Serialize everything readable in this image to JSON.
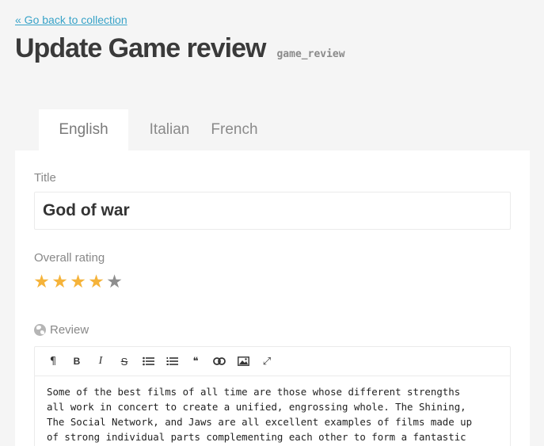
{
  "back_link": "« Go back to collection",
  "header": {
    "title": "Update Game review",
    "api_id": "game_review"
  },
  "tabs": [
    {
      "label": "English",
      "active": true
    },
    {
      "label": "Italian",
      "active": false
    },
    {
      "label": "French",
      "active": false
    }
  ],
  "form": {
    "title_label": "Title",
    "title_value": "God of war",
    "rating_label": "Overall rating",
    "rating_value": 4,
    "rating_max": 5,
    "review_label": "Review",
    "review_text": "Some of the best films of all time are those whose different strengths\nall work in concert to create a unified, engrossing whole. The Shining,\nThe Social Network, and Jaws are all excellent examples of films made up\nof strong individual parts complementing each other to form a fantastic"
  },
  "toolbar": {
    "paragraph": "¶",
    "bold": "B",
    "italic": "I",
    "strike": "S",
    "quote": "❝",
    "link": "⚭",
    "fullscreen": "⤢"
  },
  "colors": {
    "link": "#38a3c8",
    "star_on": "#f5b33a",
    "star_off": "#8e8e8e"
  }
}
